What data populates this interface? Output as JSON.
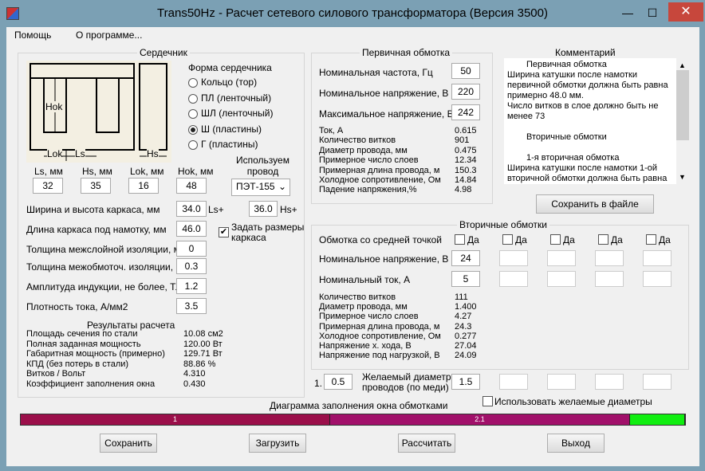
{
  "window": {
    "title": "Trans50Hz - Расчет сетевого силового трансформатора (Версия 3500)",
    "minimize": "—",
    "maximize": "☐",
    "close": "✕"
  },
  "menu": {
    "help": "Помощь",
    "about": "О программе..."
  },
  "core": {
    "group_title": "Сердечник",
    "diagram": {
      "hok": "Hok",
      "lok": "Lok",
      "ls": "Ls",
      "hs": "Hs"
    },
    "shape_title": "Форма сердечника",
    "shapes": [
      {
        "label": "Кольцо  (тор)",
        "selected": false
      },
      {
        "label": "ПЛ  (ленточный)",
        "selected": false
      },
      {
        "label": "ШЛ  (ленточный)",
        "selected": false
      },
      {
        "label": "Ш  (пластины)",
        "selected": true
      },
      {
        "label": "Г (пластины)",
        "selected": false
      }
    ],
    "dims": [
      {
        "label": "Ls, мм",
        "value": "32"
      },
      {
        "label": "Hs, мм",
        "value": "35"
      },
      {
        "label": "Lok, мм",
        "value": "16"
      },
      {
        "label": "Hok, мм",
        "value": "48"
      }
    ],
    "wire_label": "Используем\nпровод",
    "wire_value": "ПЭТ-155"
  },
  "params": [
    {
      "label": "Ширина и высота каркаса, мм",
      "value": "34.0"
    },
    {
      "label": "Длина каркаса под намотку, мм",
      "value": "46.0"
    },
    {
      "label": "Толщина межслойной изоляции, мм",
      "value": "0"
    },
    {
      "label": "Толщина межобмоточ. изоляции, мм",
      "value": "0.3"
    },
    {
      "label": "Амплитуда индукции, не более, Тл",
      "value": "1.2"
    },
    {
      "label": "Плотность тока, А/мм2",
      "value": "3.5"
    }
  ],
  "frame": {
    "ls_plus": "Ls+",
    "hs_value": "36.0",
    "hs_plus": "Hs+",
    "set_sizes_label": "Задать размеры\nкаркаса",
    "set_sizes_checked": "✔"
  },
  "results": {
    "title": "Результаты расчета",
    "rows": [
      {
        "label": "Площадь сечения по стали",
        "value": "10.08 см2"
      },
      {
        "label": "Полная заданная мощность",
        "value": "120.00 Вт"
      },
      {
        "label": "Габаритная мощность (примерно)",
        "value": "129.71 Вт"
      },
      {
        "label": "КПД (без потерь в стали)",
        "value": "88.86 %"
      },
      {
        "label": "Витков / Вольт",
        "value": "4.310"
      },
      {
        "label": "Коэффициент заполнения окна",
        "value": "0.430"
      }
    ]
  },
  "primary": {
    "title": "Первичная обмотка",
    "inputs": [
      {
        "label": "Номинальная частота, Гц",
        "value": "50"
      },
      {
        "label": "Номинальное напряжение, В",
        "value": "220"
      },
      {
        "label": "Максимальное напряжение, В",
        "value": "242"
      }
    ],
    "rows": [
      {
        "label": "Ток, А",
        "value": "0.615"
      },
      {
        "label": "Количество витков",
        "value": "901"
      },
      {
        "label": "Диаметр провода, мм",
        "value": "0.475"
      },
      {
        "label": "Примерное число слоев",
        "value": "12.34"
      },
      {
        "label": "Примерная длина провода, м",
        "value": "150.3"
      },
      {
        "label": "Холодное сопротивление, Ом",
        "value": "14.84"
      },
      {
        "label": "Падение напряжения,%",
        "value": "4.98"
      }
    ]
  },
  "comment": {
    "title": "Комментарий",
    "lines": [
      "Первичная обмотка",
      "Ширина катушки после намотки",
      "первичной обмотки должна быть равна",
      "примерно 48.0 мм.",
      "Число витков в слое должно быть не",
      "менее 73",
      "",
      "Вторичные обмотки",
      "",
      "1-я вторичная обмотка",
      "Ширина катушки после намотки 1-ой",
      "вторичной обмотки должна быть равна"
    ],
    "save_button": "Сохранить в файле",
    "scroll_up": "▲",
    "scroll_down": "▼"
  },
  "secondary": {
    "title": "Вторичные обмотки",
    "center_tap_label": "Обмотка со средней точкой",
    "yes": "Да",
    "voltage_label": "Номинальное напряжение, В",
    "current_label": "Номинальный ток, А",
    "voltages": [
      "24",
      "",
      "",
      "",
      "",
      ""
    ],
    "currents": [
      "5",
      "",
      "",
      "",
      "",
      ""
    ],
    "rows": [
      {
        "label": "Количество витков",
        "value": "111"
      },
      {
        "label": "Диаметр провода, мм",
        "value": "1.400"
      },
      {
        "label": "Примерное число слоев",
        "value": "4.27"
      },
      {
        "label": "Примерная длина провода, м",
        "value": "24.3"
      },
      {
        "label": "Холодное сопротивление, Ом",
        "value": "0.277"
      },
      {
        "label": "Напряжение х. хода, В",
        "value": "27.04"
      },
      {
        "label": "Напряжение под нагрузкой, В",
        "value": "24.09"
      }
    ],
    "desired_index": "1.",
    "desired_input": "0.5",
    "desired_label": "Желаемый диаметр\nпроводов  (по меди)",
    "desired_values": [
      "1.5",
      "",
      "",
      "",
      "",
      ""
    ],
    "use_desired_label": "Использовать желаемые диаметры"
  },
  "fill_chart": {
    "title": "Диаграмма заполнения окна обмотками",
    "segments": [
      {
        "label": "1",
        "fraction": 0.466,
        "color": "#9b0f4a"
      },
      {
        "label": "2.1",
        "fraction": 0.451,
        "color": "#a1106a"
      },
      {
        "label": "",
        "fraction": 0.083,
        "color": "#11ee11"
      }
    ]
  },
  "buttons": {
    "save": "Сохранить",
    "load": "Загрузить",
    "calculate": "Рассчитать",
    "exit": "Выход"
  }
}
